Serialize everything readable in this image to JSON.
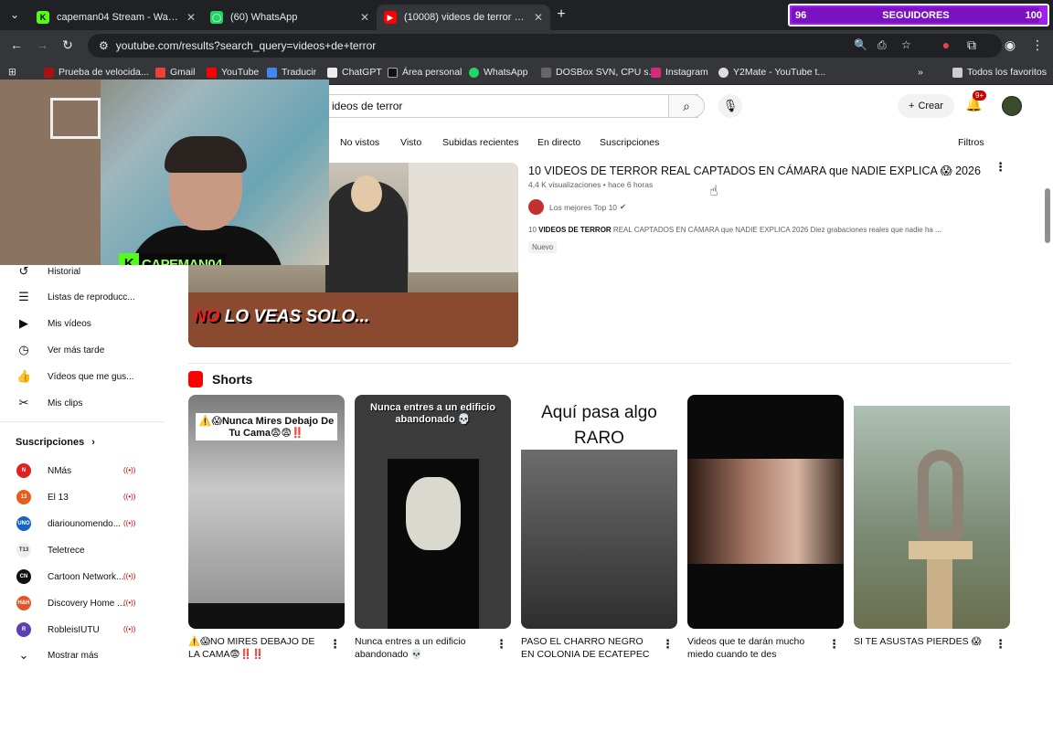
{
  "tabs": [
    {
      "title": "capeman04 Stream - Watch Live",
      "color": "#53fc18",
      "glyph": "K"
    },
    {
      "title": "(60) WhatsApp",
      "color": "#25d366",
      "glyph": "◯"
    },
    {
      "title": "(10008) videos de terror - YouTube",
      "color": "#ff0000",
      "glyph": "▶"
    }
  ],
  "new_tab": "+",
  "followers": {
    "current": "96",
    "label": "SEGUIDORES",
    "goal": "100",
    "progress": 0.96
  },
  "address": {
    "url": "youtube.com/results?search_query=videos+de+terror"
  },
  "bookmarks": [
    {
      "label": "Prueba de velocida...",
      "color": "#a11"
    },
    {
      "label": "Gmail",
      "color": "#ea4335"
    },
    {
      "label": "YouTube",
      "color": "#f00"
    },
    {
      "label": "Traducir",
      "color": "#4285f4"
    },
    {
      "label": "ChatGPT",
      "color": "#eee"
    },
    {
      "label": "Área personal",
      "color": "#333"
    },
    {
      "label": "WhatsApp",
      "color": "#25d366"
    },
    {
      "label": "DOSBox SVN, CPU s...",
      "color": "#666"
    },
    {
      "label": "Instagram",
      "color": "#d62976"
    },
    {
      "label": "Y2Mate - YouTube t...",
      "color": "#ddd"
    },
    {
      "label": "Todos los favoritos",
      "color": "#ccc"
    }
  ],
  "search": {
    "value": "ideos de terror"
  },
  "header": {
    "create_label": "Crear",
    "notif_badge": "9+"
  },
  "chips": [
    "No vistos",
    "Visto",
    "Subidas recientes",
    "En directo",
    "Suscripciones"
  ],
  "filters_label": "Filtros",
  "video": {
    "title": "10 VIDEOS DE TERROR REAL CAPTADOS EN CÁMARA que NADIE EXPLICA 😱 2026",
    "meta": "4,4 K visualizaciones • hace 6 horas",
    "channel": "Los mejores Top 10",
    "desc_bold": "VIDEOS DE TERROR",
    "desc_pre": "10 ",
    "desc_post": " REAL CAPTADOS EN CÁMARA que NADIE EXPLICA 2026 Diez grabaciones reales que nadie ha ...",
    "badge": "Nuevo",
    "thumb_caption_red": "NO",
    "thumb_caption": " LO VEAS SOLO..."
  },
  "shorts": {
    "heading": "Shorts",
    "items": [
      {
        "overlay": "⚠️😱Nunca Mires Debajo De Tu Cama😨😨‼️",
        "title": "⚠️😱NO MIRES DEBAJO DE LA CAMA😨‼️‼️"
      },
      {
        "overlay": "Nunca entres a un edificio abandonado 💀",
        "title": "Nunca entres a un edificio abandonado 💀"
      },
      {
        "overlay": "Aquí pasa algo RARO",
        "title": "PASO EL CHARRO NEGRO EN COLONIA DE ECATEPEC"
      },
      {
        "overlay": "",
        "title": "Videos que te darán mucho miedo cuando te des"
      },
      {
        "overlay": "",
        "title": "SI TE ASUSTAS PIERDES 😱"
      }
    ]
  },
  "sidebar": {
    "items": [
      {
        "label": "Historial",
        "icon": "↺"
      },
      {
        "label": "Listas de reproducc...",
        "icon": "☰"
      },
      {
        "label": "Mis vídeos",
        "icon": "▶"
      },
      {
        "label": "Ver más tarde",
        "icon": "◷"
      },
      {
        "label": "Vídeos que me gus...",
        "icon": "👍"
      },
      {
        "label": "Mis clips",
        "icon": "✂"
      }
    ],
    "subs_heading": "Suscripciones",
    "subs": [
      {
        "label": "NMás",
        "color": "#d22",
        "abbr": "N"
      },
      {
        "label": "El 13",
        "color": "#e85d1c",
        "abbr": "13"
      },
      {
        "label": "diariounomendo...",
        "color": "#1565c0",
        "abbr": "UNO"
      },
      {
        "label": "Teletrece",
        "color": "#eee",
        "abbr": "T13"
      },
      {
        "label": "Cartoon Network...",
        "color": "#111",
        "abbr": "CN"
      },
      {
        "label": "Discovery Home ...",
        "color": "#e2552a",
        "abbr": "H&H"
      },
      {
        "label": "RobleisIUTU",
        "color": "#5b3fb3",
        "abbr": "R"
      }
    ],
    "more_label": "Mostrar más"
  },
  "stream": {
    "logo": "CAPEMAN04",
    "logo_k": "K"
  }
}
